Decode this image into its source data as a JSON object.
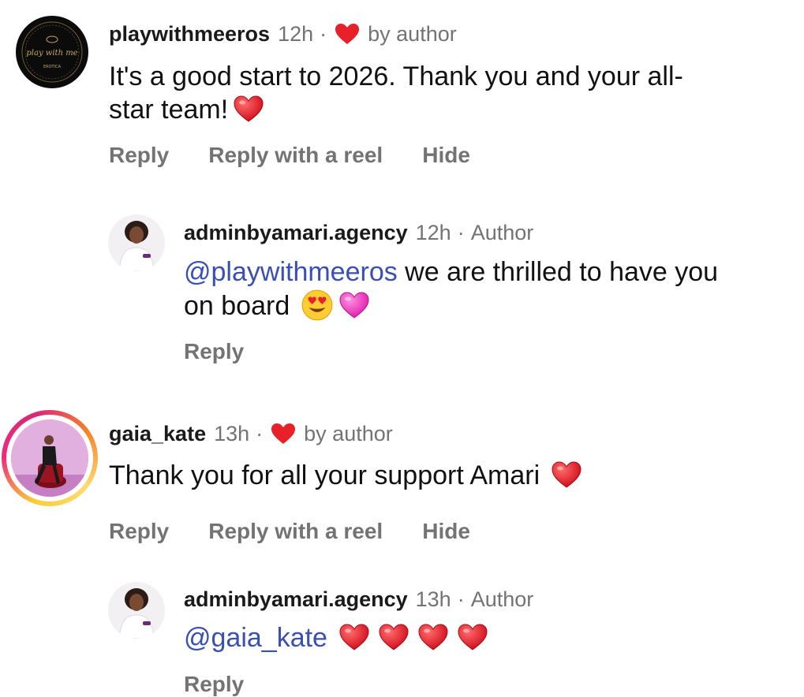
{
  "comments": [
    {
      "username": "playwithmeeros",
      "time": "12h",
      "liked_by_label": "by author",
      "text_1": "It's a good start to 2026. Thank you and your all-",
      "text_2": "star team!",
      "actions": {
        "reply": "Reply",
        "reply_reel": "Reply with a reel",
        "hide": "Hide"
      },
      "avatar_logo_text": "play with me",
      "avatar_logo_sub": "EROTICA",
      "reply": {
        "username": "adminbyamari.agency",
        "time": "12h",
        "author_label": "Author",
        "mention": "@playwithmeeros",
        "text_1": " we are thrilled to have you",
        "text_2": "on board",
        "action": "Reply"
      }
    },
    {
      "username": "gaia_kate",
      "time": "13h",
      "liked_by_label": "by author",
      "text": "Thank you for all your support Amari",
      "actions": {
        "reply": "Reply",
        "reply_reel": "Reply with a reel",
        "hide": "Hide"
      },
      "reply": {
        "username": "adminbyamari.agency",
        "time": "13h",
        "author_label": "Author",
        "mention": "@gaia_kate",
        "action": "Reply"
      }
    }
  ],
  "colors": {
    "heart": "#e8202a",
    "pink_heart": "#f040c0",
    "mention": "#3a4fb5",
    "muted": "#737373"
  },
  "separator": "·"
}
